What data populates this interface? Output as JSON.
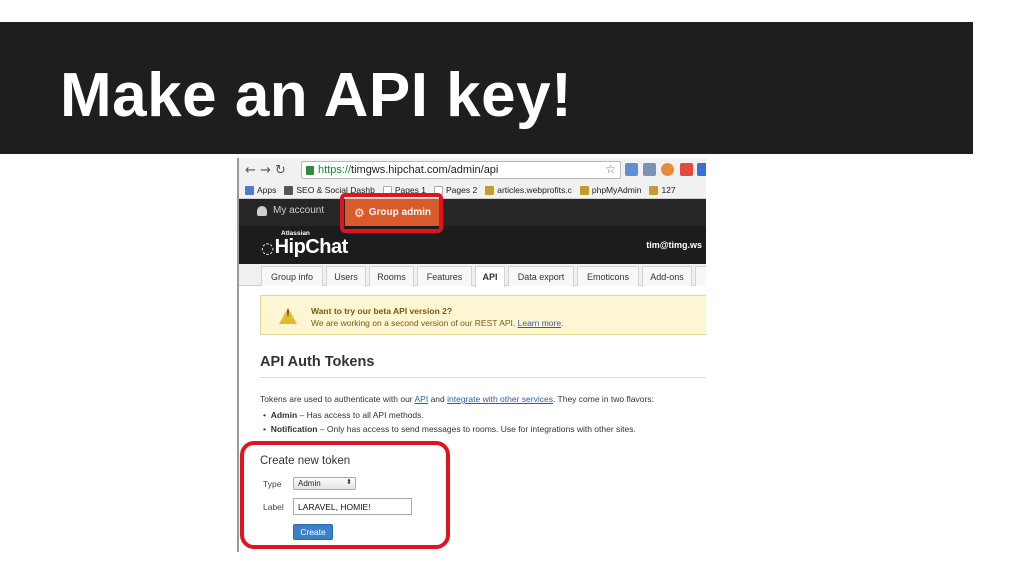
{
  "slide": {
    "title": "Make an API key!"
  },
  "browser": {
    "url_scheme": "https://",
    "url_rest": "timgws.hipchat.com/admin/api",
    "back_icon": "back-arrow-icon",
    "forward_icon": "forward-arrow-icon",
    "reload_icon": "reload-icon",
    "bookmarks": [
      {
        "label": "Apps",
        "color": "#4a7bd0"
      },
      {
        "label": "SEO & Social Dashb",
        "color": "#555555"
      },
      {
        "label": "Pages 1",
        "color": "#e8e8e8"
      },
      {
        "label": "Pages 2",
        "color": "#e8e8e8"
      },
      {
        "label": "articles.webprofits.c",
        "color": "#c69a2e"
      },
      {
        "label": "phpMyAdmin",
        "color": "#c69a2e"
      },
      {
        "label": "127",
        "color": "#c69a2e"
      }
    ]
  },
  "hipchat": {
    "tab_account": "My account",
    "tab_group_admin": "Group admin",
    "brand_small": "Atlassian",
    "brand": "HipChat",
    "user": "tim@timg.ws",
    "admin_tabs": [
      "Group info",
      "Users",
      "Rooms",
      "Features",
      "API",
      "Data export",
      "Emoticons",
      "Add-ons"
    ],
    "active_tab": "API",
    "warning": {
      "line1": "Want to try our beta API version 2?",
      "line2_prefix": "We are working on a second version of our REST API. ",
      "line2_link": "Learn more",
      "line2_suffix": "."
    },
    "section_title": "API Auth Tokens",
    "intro": {
      "p1": "Tokens are used to authenticate with our ",
      "link1": "API",
      "p2": " and ",
      "link2": "integrate with other services",
      "p3": ". They come in two flavors:"
    },
    "bullets": [
      {
        "term": "Admin",
        "desc": " – Has access to all API methods."
      },
      {
        "term": "Notification",
        "desc": " – Only has access to send messages to rooms. Use for integrations with other sites."
      }
    ],
    "create": {
      "heading": "Create new token",
      "type_label": "Type",
      "type_value": "Admin",
      "label_label": "Label",
      "label_value": "LARAVEL, HOMIE!",
      "button": "Create"
    }
  },
  "colors": {
    "highlight": "#e0141f",
    "group_admin_tab": "#d95b2b",
    "title_bar": "#1e1e1e"
  }
}
